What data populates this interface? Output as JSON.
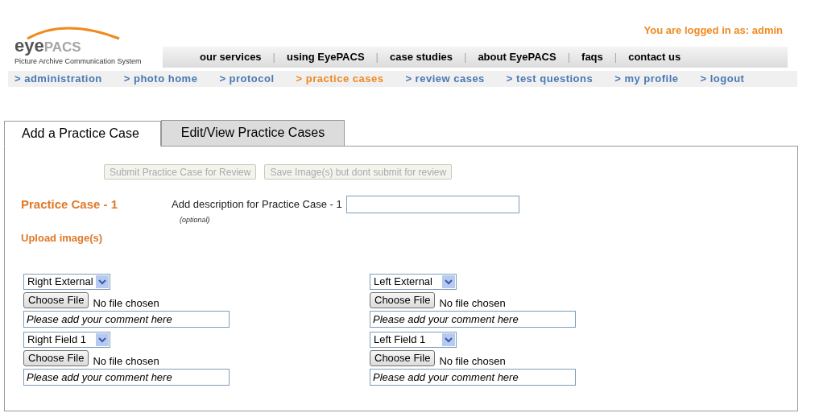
{
  "logo": {
    "name_dark": "eye",
    "name_light": "PACS",
    "tagline": "Picture Archive Communication System"
  },
  "login_status": "You are logged in as: admin",
  "top_nav": [
    "our services",
    "using EyePACS",
    "case studies",
    "about EyePACS",
    "faqs",
    "contact us"
  ],
  "top_nav_separator": "|",
  "sub_nav": [
    {
      "label": "> administration",
      "selected": false
    },
    {
      "label": "> photo home",
      "selected": false
    },
    {
      "label": "> protocol",
      "selected": false
    },
    {
      "label": "> practice cases",
      "selected": true
    },
    {
      "label": "> review cases",
      "selected": false
    },
    {
      "label": "> test questions",
      "selected": false
    },
    {
      "label": "> my profile",
      "selected": false
    },
    {
      "label": "> logout",
      "selected": false
    }
  ],
  "tabs": [
    {
      "label": "Add a Practice Case",
      "selected": true
    },
    {
      "label": "Edit/View Practice Cases",
      "selected": false
    }
  ],
  "actions": [
    {
      "label": "Submit Practice Case for Review",
      "disabled": true
    },
    {
      "label": "Save Image(s) but dont submit for review",
      "disabled": true
    }
  ],
  "case_title": "Practice Case - 1",
  "description": {
    "label": "Add description for Practice Case - 1",
    "note": "(optional)"
  },
  "upload_heading": "Upload image(s)",
  "images": [
    {
      "view": "Right External",
      "file_button": "Choose File",
      "file_status": "No file chosen",
      "comment": "Please add your comment here"
    },
    {
      "view": "Left External",
      "file_button": "Choose File",
      "file_status": "No file chosen",
      "comment": "Please add your comment here"
    },
    {
      "view": "Right Field 1",
      "file_button": "Choose File",
      "file_status": "No file chosen",
      "comment": "Please add your comment here"
    },
    {
      "view": "Left Field 1",
      "file_button": "Choose File",
      "file_status": "No file chosen",
      "comment": "Please add your comment here"
    }
  ]
}
